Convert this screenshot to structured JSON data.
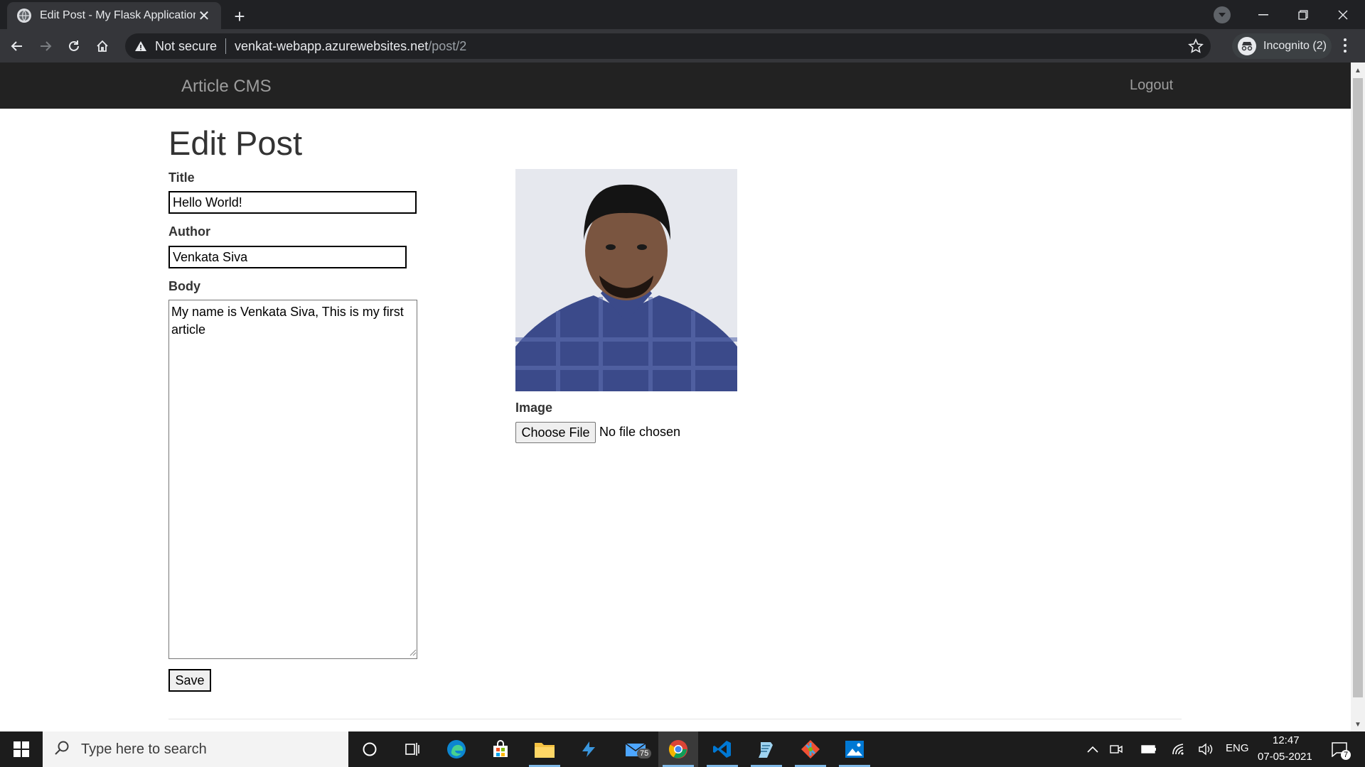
{
  "browser": {
    "tab_title": "Edit Post - My Flask Application",
    "security_label": "Not secure",
    "url_host": "venkat-webapp.azurewebsites.net",
    "url_path": "/post/2",
    "incognito_label": "Incognito (2)"
  },
  "site": {
    "brand": "Article CMS",
    "logout": "Logout"
  },
  "form": {
    "heading": "Edit Post",
    "title_label": "Title",
    "title_value": "Hello World!",
    "author_label": "Author",
    "author_value": "Venkata Siva",
    "body_label": "Body",
    "body_value": "My name is Venkata Siva, This is my first article",
    "image_label": "Image",
    "choose_file": "Choose File",
    "no_file": "No file chosen",
    "save": "Save"
  },
  "taskbar": {
    "search_placeholder": "Type here to search",
    "mail_badge": "75",
    "language": "ENG",
    "time": "12:47",
    "date": "07-05-2021",
    "notification_count": "7"
  },
  "colors": {
    "navbar": "#222222",
    "chrome_dark": "#202124",
    "chrome_toolbar": "#35363a",
    "taskbar": "#1c1c1c"
  }
}
